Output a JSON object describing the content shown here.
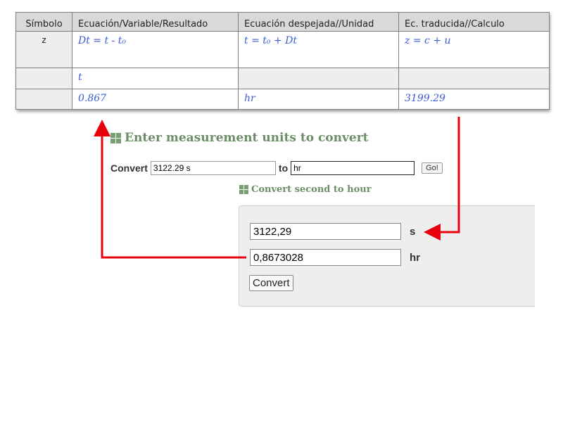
{
  "table": {
    "headers": [
      "Símbolo",
      "Ecuación/Variable/Resultado",
      "Ecuación despejada//Unidad",
      "Ec. traducida//Calculo"
    ],
    "rows": [
      [
        "z",
        "Dt = t - t₀",
        "t = t₀ + Dt",
        "z = c + u"
      ],
      [
        "",
        "t",
        "",
        ""
      ],
      [
        "",
        "0.867",
        "hr",
        "3199.29"
      ]
    ]
  },
  "converter": {
    "title": "Enter measurement units to convert",
    "convert_label": "Convert",
    "from_value": "3122.29 s",
    "to_label": "to",
    "to_value": "hr",
    "go_label": "Go!",
    "subtitle": "Convert second to hour",
    "input_seconds": "3122,29",
    "unit_seconds": "s",
    "input_hours": "0,8673028",
    "unit_hours": "hr",
    "convert_button": "Convert"
  },
  "colors": {
    "arrow": "#e8000d",
    "handwriting": "#3b5bd6",
    "heading_green": "#6b8e66"
  }
}
